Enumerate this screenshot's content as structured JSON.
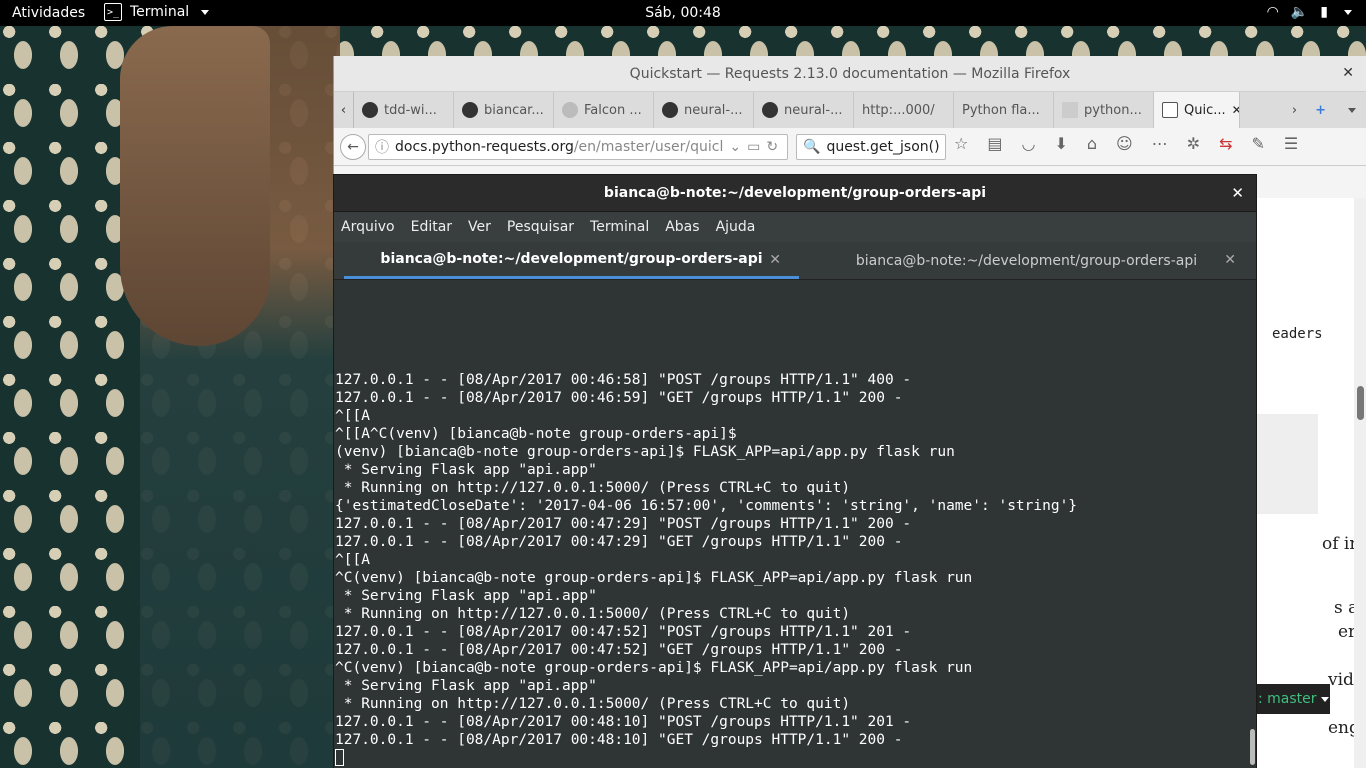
{
  "topbar": {
    "activities": "Atividades",
    "app_name": "Terminal",
    "clock": "Sáb, 00:48"
  },
  "firefox": {
    "title": "Quickstart — Requests 2.13.0 documentation — Mozilla Firefox",
    "tabs": [
      {
        "label": "tdd-wi..."
      },
      {
        "label": "biancar..."
      },
      {
        "label": "Falcon ..."
      },
      {
        "label": "neural-..."
      },
      {
        "label": "neural-..."
      },
      {
        "label": "http:...000/"
      },
      {
        "label": "Python fla..."
      },
      {
        "label": "python..."
      },
      {
        "label": "Quic..."
      }
    ],
    "url_domain": "docs.python-requests.org",
    "url_path": "/en/master/user/quicl",
    "search_value": "quest.get_json()",
    "page": {
      "frag1": "eaders",
      "frag2": "of in-",
      "frag3": "s are",
      "frag4": "er.",
      "frag5": "vided",
      "badge": ": master",
      "frag6": "ength"
    }
  },
  "terminal": {
    "title": "bianca@b-note:~/development/group-orders-api",
    "menu": [
      "Arquivo",
      "Editar",
      "Ver",
      "Pesquisar",
      "Terminal",
      "Abas",
      "Ajuda"
    ],
    "tabs": [
      {
        "label": "bianca@b-note:~/development/group-orders-api"
      },
      {
        "label": "bianca@b-note:~/development/group-orders-api"
      }
    ],
    "lines": [
      "127.0.0.1 - - [08/Apr/2017 00:46:58] \"POST /groups HTTP/1.1\" 400 -",
      "127.0.0.1 - - [08/Apr/2017 00:46:59] \"GET /groups HTTP/1.1\" 200 -",
      "^[[A",
      "^[[A^C(venv) [bianca@b-note group-orders-api]$",
      "(venv) [bianca@b-note group-orders-api]$ FLASK_APP=api/app.py flask run",
      " * Serving Flask app \"api.app\"",
      " * Running on http://127.0.0.1:5000/ (Press CTRL+C to quit)",
      "{'estimatedCloseDate': '2017-04-06 16:57:00', 'comments': 'string', 'name': 'string'}",
      "127.0.0.1 - - [08/Apr/2017 00:47:29] \"POST /groups HTTP/1.1\" 200 -",
      "127.0.0.1 - - [08/Apr/2017 00:47:29] \"GET /groups HTTP/1.1\" 200 -",
      "^[[A",
      "^C(venv) [bianca@b-note group-orders-api]$ FLASK_APP=api/app.py flask run",
      " * Serving Flask app \"api.app\"",
      " * Running on http://127.0.0.1:5000/ (Press CTRL+C to quit)",
      "127.0.0.1 - - [08/Apr/2017 00:47:52] \"POST /groups HTTP/1.1\" 201 -",
      "127.0.0.1 - - [08/Apr/2017 00:47:52] \"GET /groups HTTP/1.1\" 200 -",
      "^C(venv) [bianca@b-note group-orders-api]$ FLASK_APP=api/app.py flask run",
      " * Serving Flask app \"api.app\"",
      " * Running on http://127.0.0.1:5000/ (Press CTRL+C to quit)",
      "127.0.0.1 - - [08/Apr/2017 00:48:10] \"POST /groups HTTP/1.1\" 201 -",
      "127.0.0.1 - - [08/Apr/2017 00:48:10] \"GET /groups HTTP/1.1\" 200 -"
    ]
  }
}
